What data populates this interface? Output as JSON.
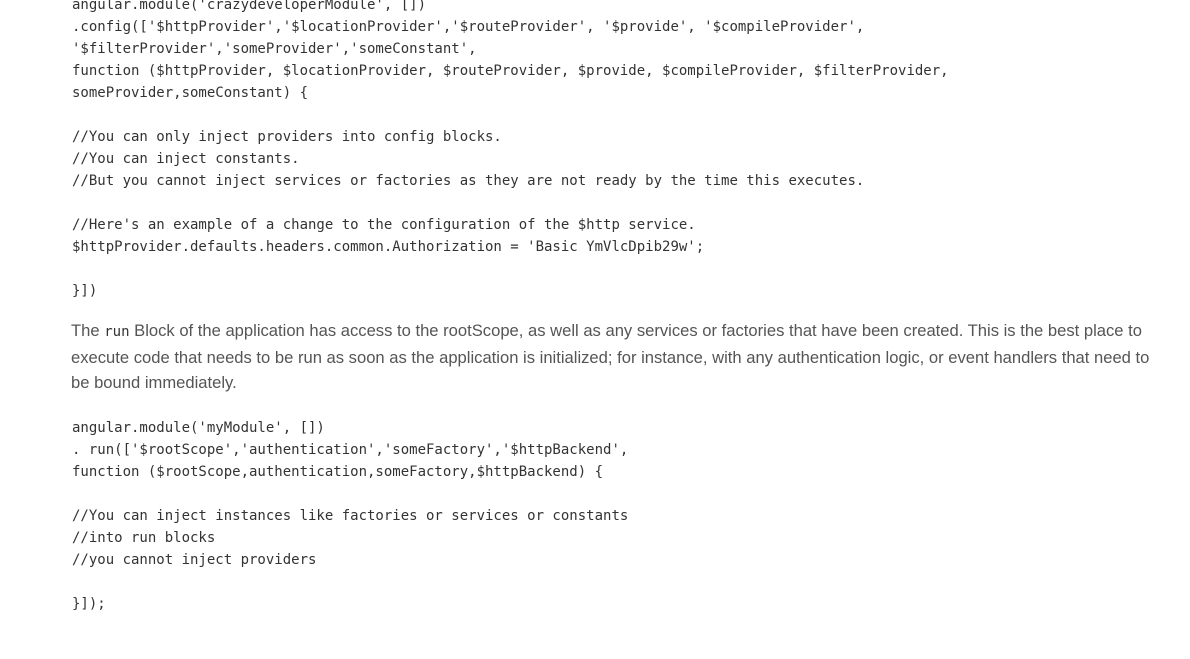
{
  "config_block": {
    "lines": [
      "angular.module('crazydeveloperModule', [])",
      ".config(['$httpProvider','$locationProvider','$routeProvider', '$provide', '$compileProvider',",
      "'$filterProvider','someProvider','someConstant',",
      "function ($httpProvider, $locationProvider, $routeProvider, $provide, $compileProvider, $filterProvider,",
      "someProvider,someConstant) {",
      "",
      "//You can only inject providers into config blocks.",
      "//You can inject constants.",
      "//But you cannot inject services or factories as they are not ready by the time this executes.",
      "",
      "//Here's an example of a change to the configuration of the $http service.",
      "$httpProvider.defaults.headers.common.Authorization = 'Basic YmVlcDpib29w';",
      "",
      "}])"
    ]
  },
  "paragraph": {
    "prefix": "The ",
    "keyword": "run",
    "suffix": " Block of the application has access to the rootScope, as well as any services or factories that have been created. This is the best place to execute code that needs to be run as soon as the application is initialized; for instance, with any authentication logic, or event handlers that need to be bound immediately."
  },
  "run_block": {
    "lines": [
      "angular.module('myModule', [])",
      ". run(['$rootScope','authentication','someFactory','$httpBackend',",
      "function ($rootScope,authentication,someFactory,$httpBackend) {",
      "",
      "//You can inject instances like factories or services or constants",
      "//into run blocks",
      "//you cannot inject providers",
      "",
      "}]);"
    ]
  }
}
